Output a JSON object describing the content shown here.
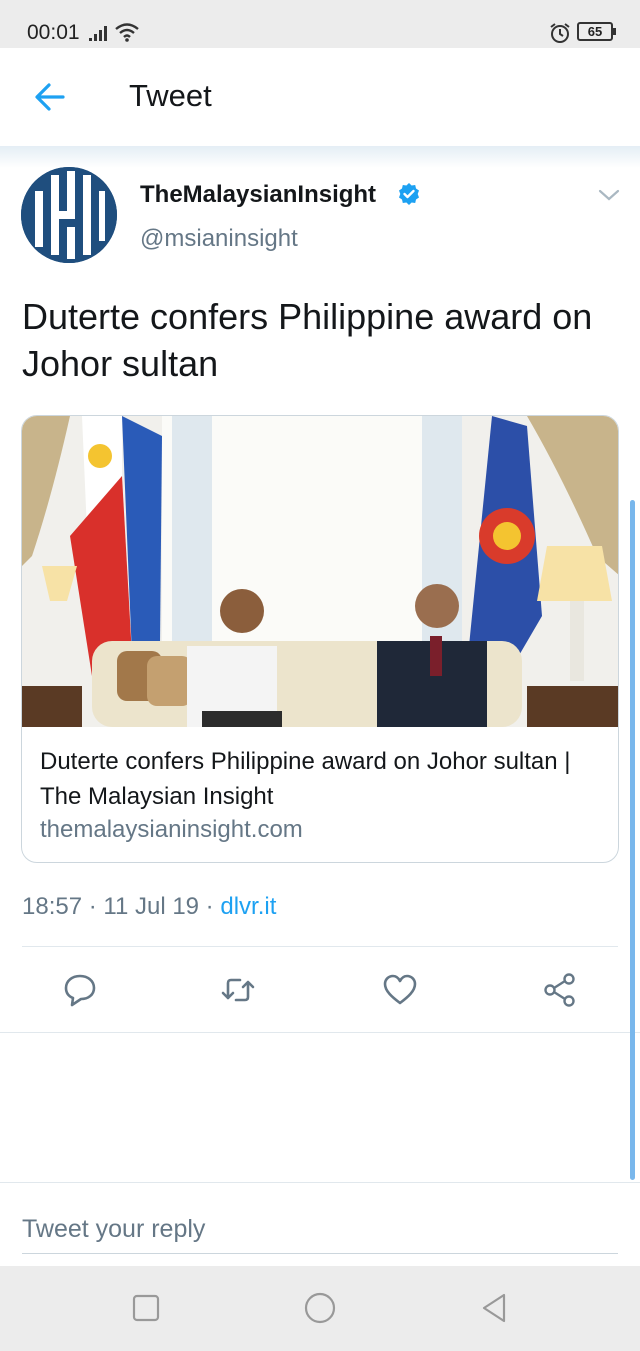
{
  "status_bar": {
    "time": "00:01",
    "battery": "65"
  },
  "header": {
    "title": "Tweet"
  },
  "tweet": {
    "display_name": "TheMalaysianInsight",
    "handle": "@msianinsight",
    "text": "Duterte confers Philippine award on Johor sultan",
    "card": {
      "title": "Duterte confers Philippine award on Johor sultan | The Malaysian Insight",
      "domain": "themalaysianinsight.com"
    },
    "time": "18:57",
    "separator": " · ",
    "date": "11 Jul 19",
    "source": "dlvr.it"
  },
  "actions": {
    "reply_icon": "speech-bubble",
    "retweet_icon": "retweet-arrows",
    "like_icon": "heart",
    "share_icon": "share-nodes"
  },
  "reply": {
    "placeholder": "Tweet your reply"
  },
  "colors": {
    "accent": "#1da1f2",
    "text_primary": "#14171a",
    "text_secondary": "#657786",
    "avatar_bg": "#1f4e7e"
  }
}
